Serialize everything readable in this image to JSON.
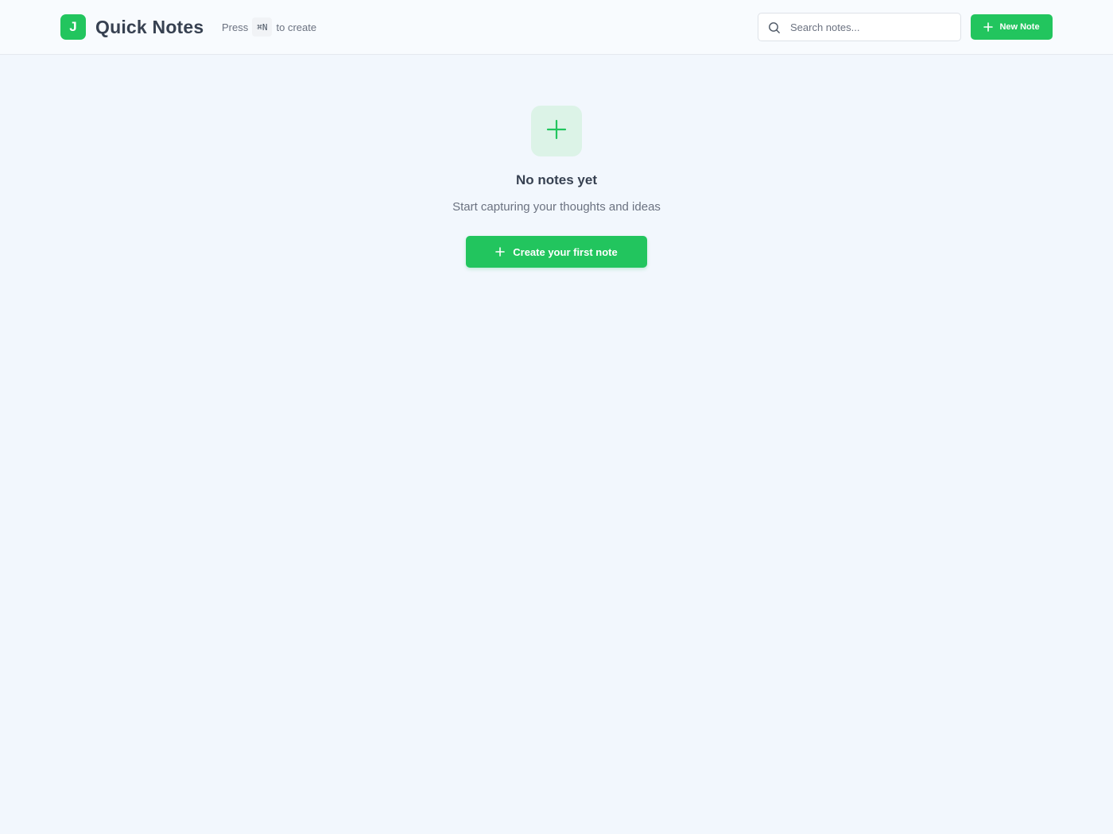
{
  "header": {
    "logo_letter": "J",
    "app_title": "Quick Notes",
    "hint_prefix": "Press",
    "hint_key": "⌘N",
    "hint_suffix": "to create",
    "search_placeholder": "Search notes...",
    "new_note_label": "New Note"
  },
  "empty_state": {
    "title": "No notes yet",
    "subtitle": "Start capturing your thoughts and ideas",
    "cta_label": "Create your first note"
  },
  "icons": {
    "search": "search-icon",
    "plus": "plus-icon"
  },
  "colors": {
    "accent": "#22c55e",
    "accent_soft": "#dcf3e7",
    "background": "#f2f7fd"
  }
}
